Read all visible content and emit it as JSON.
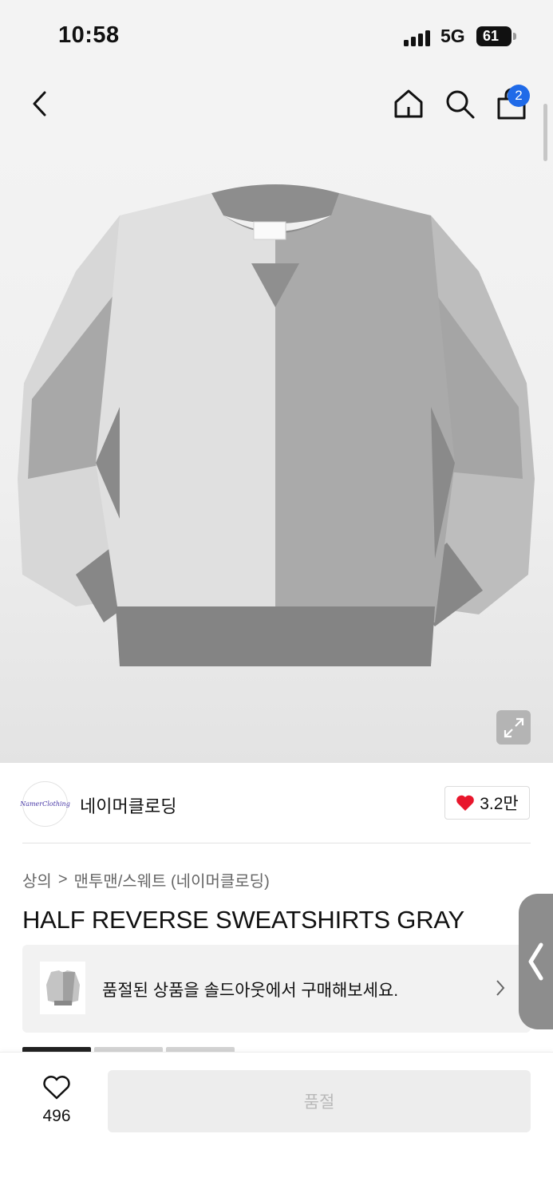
{
  "status_bar": {
    "time": "10:58",
    "network": "5G",
    "battery": "61"
  },
  "nav": {
    "cart_count": "2",
    "icons": [
      "back-icon",
      "home-icon",
      "search-icon",
      "cart-icon"
    ]
  },
  "brand": {
    "logo_text": "NamerClothing",
    "name": "네이머클로딩",
    "like_count": "3.2만"
  },
  "breadcrumb": {
    "category": "상의",
    "separator": ">",
    "subcategory": "맨투맨/스웨트 (네이머클로딩)"
  },
  "product": {
    "title": "HALF REVERSE SWEATSHIRTS GRAY"
  },
  "soldout_banner": {
    "text": "품절된 상품을 솔드아웃에서 구매해보세요."
  },
  "bottom_bar": {
    "wish_count": "496",
    "buy_label": "품절"
  },
  "colors": {
    "accent_blue": "#1f6ae8",
    "heart_red": "#e8162c",
    "sweatshirt_light": "#dcdcdc",
    "sweatshirt_mid": "#a9a9a9",
    "sweatshirt_dark": "#858585"
  }
}
